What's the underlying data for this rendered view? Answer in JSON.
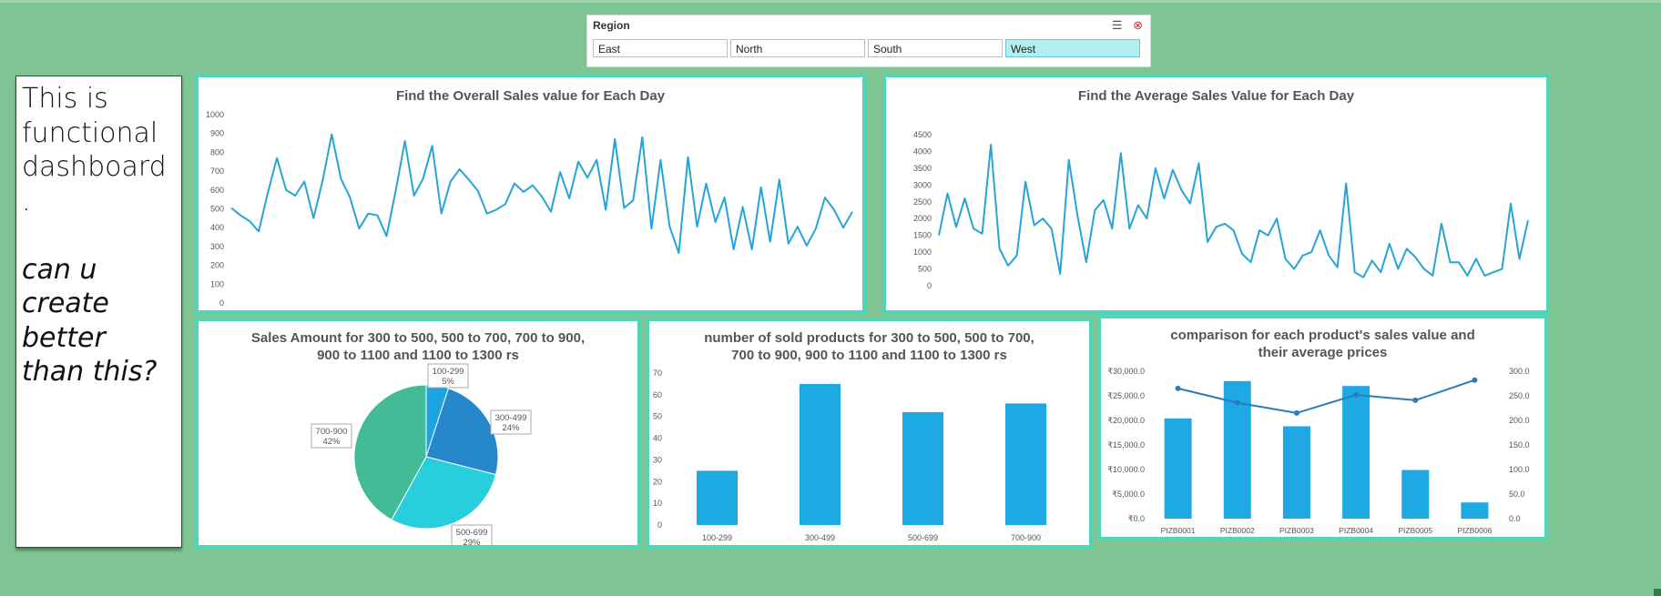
{
  "slicer": {
    "title": "Region",
    "filter_icon": "multi-select-icon",
    "clear_icon": "clear-filter-icon",
    "items": [
      {
        "label": "East",
        "selected": false
      },
      {
        "label": "North",
        "selected": false
      },
      {
        "label": "South",
        "selected": false
      },
      {
        "label": "West",
        "selected": true
      }
    ]
  },
  "note": {
    "line1": "This is\nfunctional\ndashboard\n.",
    "line2": "can u\ncreate\nbetter\nthan this?"
  },
  "colors": {
    "background": "#7fc593",
    "panel_border": "#4fd6b8",
    "line_series": "#27a4d6",
    "bar_series": "#1ea9e4",
    "pie_slices": [
      "#1da4e0",
      "#2787cb",
      "#28cedb",
      "#42bb96"
    ]
  },
  "chart_data": [
    {
      "id": "overall",
      "type": "line",
      "title": "Find the Overall Sales value for Each Day",
      "ylim": [
        0,
        1000
      ],
      "yticks": [
        0,
        100,
        200,
        300,
        400,
        500,
        600,
        700,
        800,
        900,
        1000
      ],
      "grid": false,
      "values": [
        505,
        465,
        435,
        380,
        585,
        770,
        600,
        570,
        645,
        450,
        650,
        895,
        660,
        560,
        395,
        475,
        465,
        355,
        595,
        860,
        570,
        660,
        835,
        475,
        645,
        710,
        655,
        595,
        475,
        495,
        525,
        635,
        590,
        625,
        565,
        485,
        695,
        555,
        750,
        665,
        760,
        495,
        870,
        505,
        545,
        880,
        395,
        760,
        405,
        265,
        775,
        405,
        635,
        430,
        560,
        285,
        510,
        285,
        615,
        325,
        655,
        315,
        405,
        305,
        395,
        560,
        495,
        400,
        485
      ]
    },
    {
      "id": "average",
      "type": "line",
      "title": "Find the Average Sales Value for Each Day",
      "ylim": [
        0,
        4500
      ],
      "yticks": [
        0,
        500,
        1000,
        1500,
        2000,
        2500,
        3000,
        3500,
        4000,
        4500
      ],
      "grid": false,
      "values": [
        1500,
        2750,
        1750,
        2600,
        1700,
        1550,
        4200,
        1100,
        600,
        900,
        3100,
        1800,
        2000,
        1700,
        350,
        3750,
        2100,
        700,
        2250,
        2550,
        1700,
        3950,
        1700,
        2400,
        2000,
        3500,
        2600,
        3450,
        2850,
        2450,
        3650,
        1300,
        1750,
        1850,
        1650,
        950,
        700,
        1650,
        1500,
        2000,
        800,
        500,
        900,
        1000,
        1650,
        900,
        550,
        3050,
        400,
        250,
        750,
        400,
        1250,
        500,
        1100,
        850,
        500,
        300,
        1850,
        700,
        700,
        300,
        800,
        300,
        400,
        500,
        2450,
        800,
        1950
      ]
    },
    {
      "id": "pie",
      "type": "pie",
      "title": "Sales Amount for 300 to 500, 500 to 700, 700 to 900,\n900 to 1100 and 1100 to 1300 rs",
      "slices": [
        {
          "label": "100-299",
          "value": 5,
          "text": "5%"
        },
        {
          "label": "300-499",
          "value": 24,
          "text": "24%"
        },
        {
          "label": "500-699",
          "value": 29,
          "text": "29%"
        },
        {
          "label": "700-900",
          "value": 42,
          "text": "42%"
        }
      ]
    },
    {
      "id": "bar",
      "type": "bar",
      "title": "number of sold products for 300 to 500, 500 to 700,\n700 to 900, 900 to 1100 and 1100 to 1300 rs",
      "categories": [
        "100-299",
        "300-499",
        "500-699",
        "700-900"
      ],
      "values": [
        25,
        65,
        52,
        56
      ],
      "ylim": [
        0,
        70
      ],
      "yticks": [
        0,
        10,
        20,
        30,
        40,
        50,
        60,
        70
      ]
    },
    {
      "id": "combo",
      "type": "bar",
      "title": "comparison for each product's sales value and\ntheir average prices",
      "categories": [
        "PIZB0001",
        "PIZB0002",
        "PIZB0003",
        "PIZB0004",
        "PIZB0005",
        "PIZB0006"
      ],
      "series": [
        {
          "type": "bar",
          "axis": "left",
          "values": [
            20400,
            28000,
            18800,
            27000,
            9900,
            3300
          ]
        },
        {
          "type": "line",
          "axis": "right",
          "values": [
            265,
            236,
            215,
            252,
            241,
            282
          ]
        }
      ],
      "ylim_left": [
        0,
        30000
      ],
      "yticks_left": [
        "₹0.0",
        "₹5,000.0",
        "₹10,000.0",
        "₹15,000.0",
        "₹20,000.0",
        "₹25,000.0",
        "₹30,000.0"
      ],
      "ylim_right": [
        0,
        300
      ],
      "yticks_right": [
        "0.0",
        "50.0",
        "100.0",
        "150.0",
        "200.0",
        "250.0",
        "300.0"
      ]
    }
  ]
}
